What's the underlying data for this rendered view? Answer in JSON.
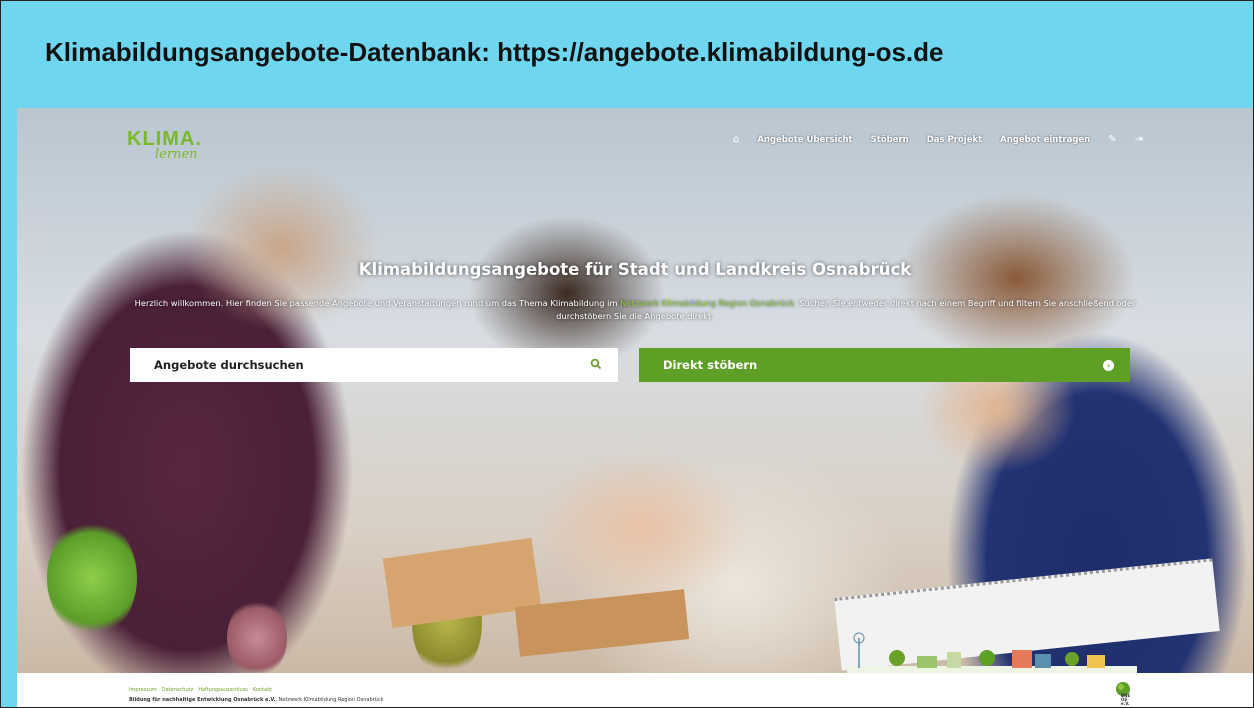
{
  "slide": {
    "title": "Klimabildungsangebote-Datenbank: https://angebote.klimabildung-os.de"
  },
  "site": {
    "logo": {
      "main": "KLIMA.",
      "sub": "lernen"
    },
    "nav": {
      "home_icon": "home-icon",
      "items": [
        "Angebote Übersicht",
        "Stöbern",
        "Das Projekt",
        "Angebot eintragen"
      ],
      "extra_icons": [
        "edit-icon",
        "login-icon"
      ]
    },
    "hero": {
      "title": "Klimabildungsangebote für Stadt und Landkreis Osnabrück",
      "text_before_link": "Herzlich willkommen. Hier finden Sie passende Angebote und Veranstaltungen rund um das Thema Klimabildung im ",
      "link": "Netzwerk Klimabildung Region Osnabrück",
      "text_after_link": ". Suchen Sie entweder direkt nach einem Begriff und filtern Sie anschließend oder durchstöbern Sie die Angebote direkt."
    },
    "search": {
      "label": "Angebote durchsuchen",
      "icon": "search-icon"
    },
    "browse": {
      "label": "Direkt stöbern",
      "icon": "arrow-right-circle-icon"
    },
    "footer": {
      "links": [
        "Impressum",
        "Datenschutz",
        "Haftungsausschluss",
        "Kontakt"
      ],
      "org_bold": "Bildung für nachhaltige Entwicklung Osnabrück e.V.",
      "org_rest": ", Netzwerk Klimabildung Region Osnabrück",
      "logo_text": "BNE OS e.V."
    }
  },
  "colors": {
    "slide_bg": "#6fd6f0",
    "brand_green": "#7ab929",
    "button_green": "#5e9f26"
  }
}
